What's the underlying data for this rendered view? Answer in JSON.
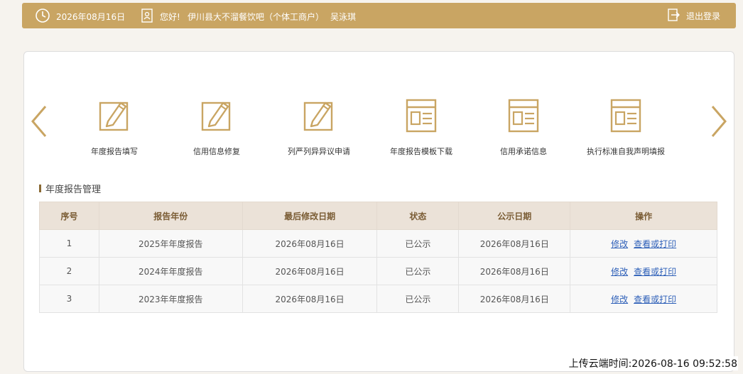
{
  "header": {
    "date": "2026年08月16日",
    "greeting": "您好!",
    "company": "伊川县大不溜餐饮吧（个体工商户）",
    "person": "吴泳琪",
    "logout_label": "退出登录"
  },
  "shortcuts": [
    {
      "label": "年度报告填写",
      "icon": "edit-form-icon"
    },
    {
      "label": "信用信息修复",
      "icon": "edit-form-icon"
    },
    {
      "label": "列严列异异议申请",
      "icon": "edit-form-icon"
    },
    {
      "label": "年度报告模板下载",
      "icon": "document-window-icon"
    },
    {
      "label": "信用承诺信息",
      "icon": "document-window-icon"
    },
    {
      "label": "执行标准自我声明填报",
      "icon": "document-window-icon"
    }
  ],
  "section": {
    "title": "年度报告管理"
  },
  "table": {
    "headers": [
      "序号",
      "报告年份",
      "最后修改日期",
      "状态",
      "公示日期",
      "操作"
    ],
    "rows": [
      {
        "no": "1",
        "year": "2025年年度报告",
        "modified": "2026年08月16日",
        "status": "已公示",
        "published": "2026年08月16日",
        "edit": "修改",
        "view": "查看或打印"
      },
      {
        "no": "2",
        "year": "2024年年度报告",
        "modified": "2026年08月16日",
        "status": "已公示",
        "published": "2026年08月16日",
        "edit": "修改",
        "view": "查看或打印"
      },
      {
        "no": "3",
        "year": "2023年年度报告",
        "modified": "2026年08月16日",
        "status": "已公示",
        "published": "2026年08月16日",
        "edit": "修改",
        "view": "查看或打印"
      }
    ]
  },
  "footer": {
    "upload_time": "上传云端时间:2026-08-16 09:52:58"
  },
  "colors": {
    "accent": "#c9a563",
    "header_bg": "#ebe2d8",
    "link": "#2d5fb8"
  }
}
